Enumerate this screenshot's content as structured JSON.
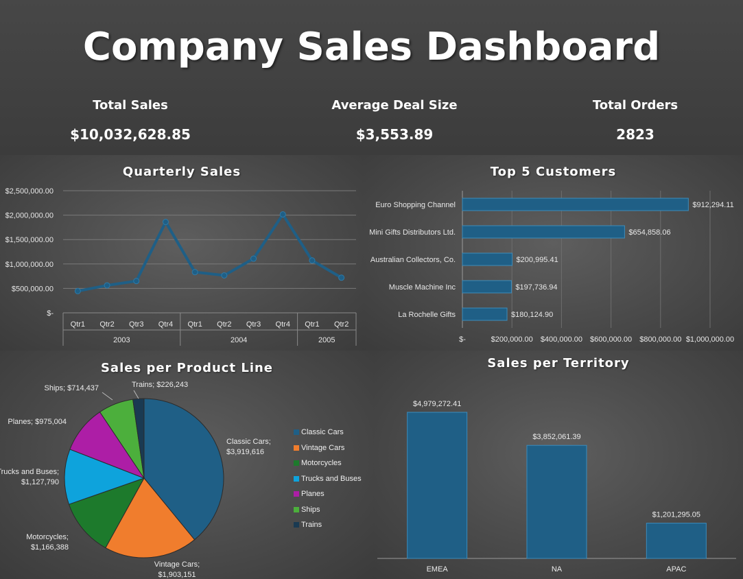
{
  "title": "Company Sales Dashboard",
  "kpis": [
    {
      "label": "Total Sales",
      "value": "$10,032,628.85"
    },
    {
      "label": "Average Deal Size",
      "value": "$3,553.89"
    },
    {
      "label": "Total Orders",
      "value": "2823"
    }
  ],
  "chart_data": [
    {
      "type": "line",
      "title": "Quarterly Sales",
      "color": "#1f5f86",
      "y_ticks": [
        "$-",
        "$500,000.00",
        "$1,000,000.00",
        "$1,500,000.00",
        "$2,000,000.00",
        "$2,500,000.00"
      ],
      "ylim": [
        0,
        2500000
      ],
      "categories": [
        "Qtr1",
        "Qtr2",
        "Qtr3",
        "Qtr4",
        "Qtr1",
        "Qtr2",
        "Qtr3",
        "Qtr4",
        "Qtr1",
        "Qtr2"
      ],
      "years": [
        {
          "label": "2003",
          "quarters": 4
        },
        {
          "label": "2004",
          "quarters": 4
        },
        {
          "label": "2005",
          "quarters": 2
        }
      ],
      "values": [
        445094,
        562365,
        650987,
        1860579,
        833731,
        766261,
        1109396,
        2014775,
        1071993,
        719495
      ],
      "grid": true
    },
    {
      "type": "bar",
      "orientation": "horizontal",
      "title": "Top 5 Customers",
      "color": "#1f5f86",
      "categories": [
        "Euro Shopping Channel",
        "Mini Gifts Distributors Ltd.",
        "Australian Collectors, Co.",
        "Muscle Machine Inc",
        "La Rochelle Gifts"
      ],
      "values": [
        912294.11,
        654858.06,
        200995.41,
        197736.94,
        180124.9
      ],
      "data_labels": [
        "$912,294.11",
        "$654,858.06",
        "$200,995.41",
        "$197,736.94",
        "$180,124.90"
      ],
      "x_ticks": [
        "$-",
        "$200,000.00",
        "$400,000.00",
        "$600,000.00",
        "$800,000.00",
        "$1,000,000.00"
      ],
      "xlim": [
        0,
        1000000
      ],
      "grid": true
    },
    {
      "type": "pie",
      "title": "Sales per Product Line",
      "slices": [
        {
          "name": "Classic Cars",
          "value": 3919616,
          "color": "#1f5f86",
          "label": [
            "Classic Cars;",
            "$3,919,616"
          ]
        },
        {
          "name": "Vintage Cars",
          "value": 1903151,
          "color": "#f07d2d",
          "label": [
            "Vintage Cars;",
            "$1,903,151"
          ]
        },
        {
          "name": "Motorcycles",
          "value": 1166388,
          "color": "#1d7a2c",
          "label": [
            "Motorcycles;",
            "$1,166,388"
          ]
        },
        {
          "name": "Trucks and Buses",
          "value": 1127790,
          "color": "#0ea3dc",
          "label": [
            "Trucks and Buses;",
            "$1,127,790"
          ]
        },
        {
          "name": "Planes",
          "value": 975004,
          "color": "#ad1ea6",
          "label": [
            "Planes; $975,004"
          ]
        },
        {
          "name": "Ships",
          "value": 714437,
          "color": "#4caf3c",
          "label": [
            "Ships; $714,437"
          ]
        },
        {
          "name": "Trains",
          "value": 226243,
          "color": "#1a3a52",
          "label": [
            "Trains; $226,243"
          ]
        }
      ],
      "legend": "right"
    },
    {
      "type": "bar",
      "orientation": "vertical",
      "title": "Sales per Territory",
      "color": "#1f5f86",
      "categories": [
        "EMEA",
        "NA",
        "APAC"
      ],
      "values": [
        4979272.41,
        3852061.39,
        1201295.05
      ],
      "data_labels": [
        "$4,979,272.41",
        "$3,852,061.39",
        "$1,201,295.05"
      ]
    }
  ]
}
